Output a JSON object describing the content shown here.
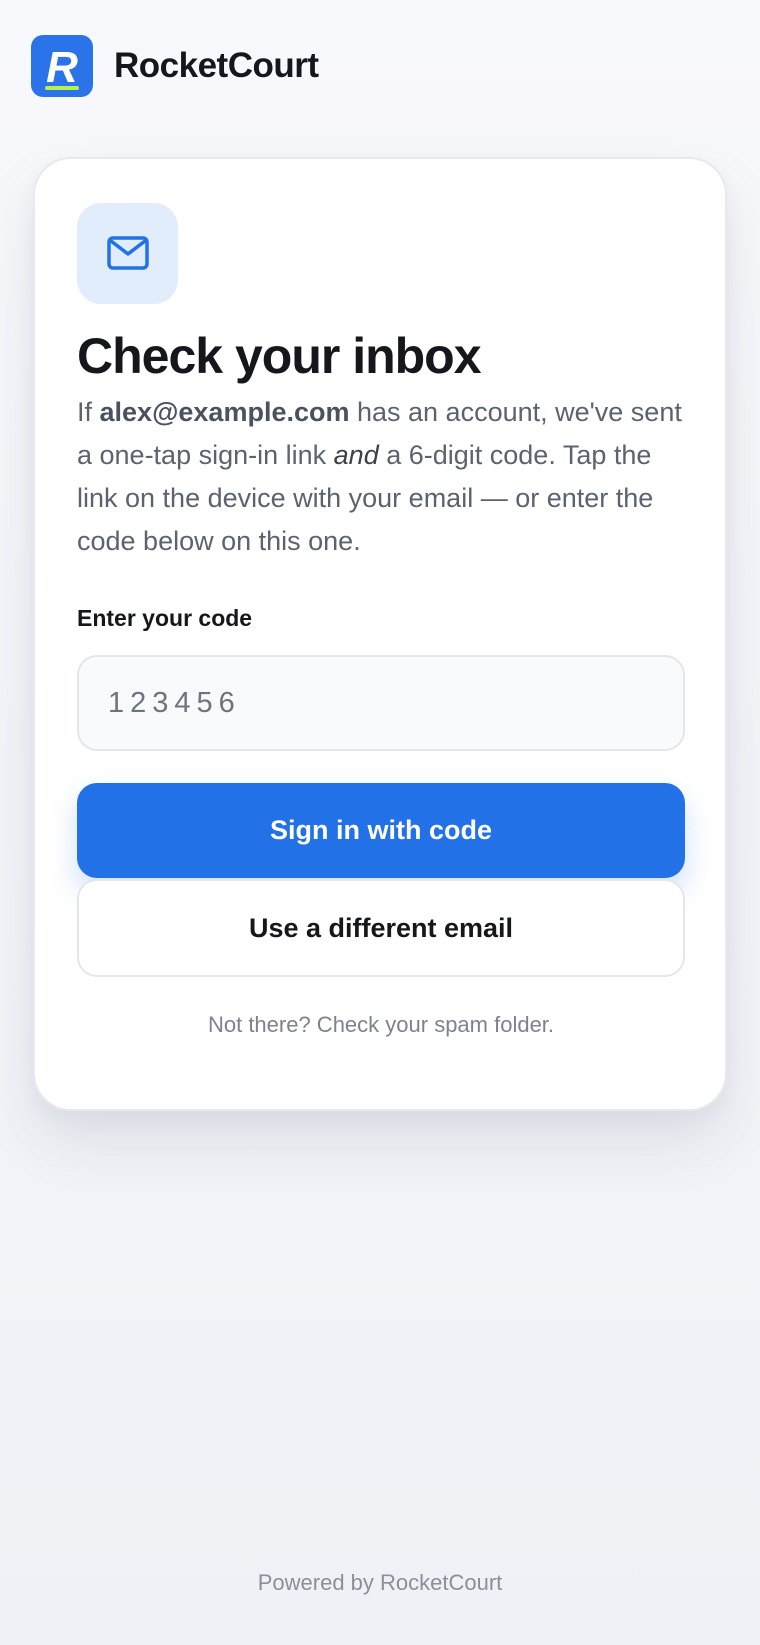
{
  "header": {
    "brand_name": "RocketCourt",
    "logo_icon": "rocketcourt-logo-icon",
    "logo_letter": "R"
  },
  "card": {
    "badge_icon": "mail-icon",
    "title": "Check your inbox",
    "description": {
      "prefix": "If ",
      "email": "alex@example.com",
      "part2": " has an account, we've sent a one-tap sign-in link ",
      "emphasis": "and",
      "part3": " a 6-digit code. Tap the link on the device with your email — or enter the code below on this one."
    },
    "code_field": {
      "label": "Enter your code",
      "placeholder": "123456",
      "value": ""
    },
    "primary_button": "Sign in with code",
    "secondary_button": "Use a different email",
    "spam_note": "Not there? Check your spam folder."
  },
  "footer": {
    "powered_by": "Powered by RocketCourt"
  },
  "colors": {
    "accent": "#2271e6",
    "logo_background": "#2a73e8",
    "logo_underline": "#b9f04a",
    "badge_background": "#e2edfc",
    "page_background": "#f3f5f9"
  }
}
